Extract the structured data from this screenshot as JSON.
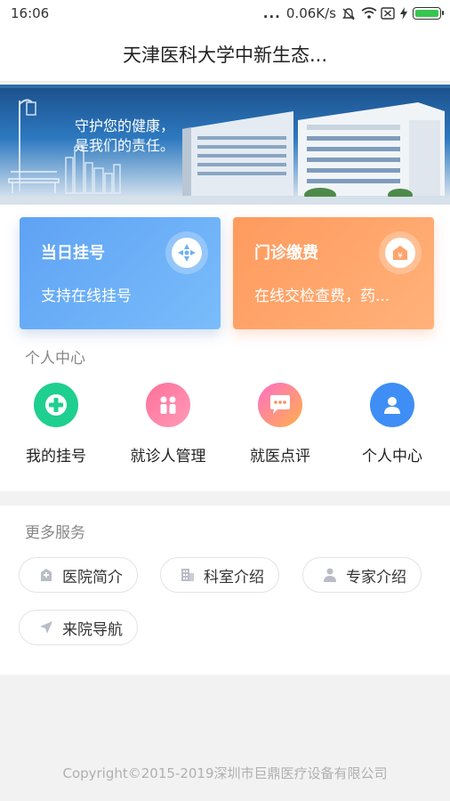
{
  "status_bar": {
    "time": "16:06",
    "dots": "...",
    "network_speed": "0.06K/s"
  },
  "header": {
    "title": "天津医科大学中新生态..."
  },
  "banner": {
    "line1": "守护您的健康，",
    "line2": "是我们的责任。"
  },
  "cards": [
    {
      "title": "当日挂号",
      "subtitle": "支持在线挂号",
      "icon": "registration-icon",
      "color": "#6aaff7"
    },
    {
      "title": "门诊缴费",
      "subtitle": "在线交检查费，药...",
      "icon": "payment-icon",
      "color": "#ffa36c"
    }
  ],
  "personal_center": {
    "label": "个人中心",
    "items": [
      {
        "label": "我的挂号",
        "icon": "plus-icon",
        "color": "#1fcf8f"
      },
      {
        "label": "就诊人管理",
        "icon": "people-icon",
        "color": "#ff6f9a"
      },
      {
        "label": "就医点评",
        "icon": "comment-icon",
        "color": "#ff8a5c"
      },
      {
        "label": "个人中心",
        "icon": "user-icon",
        "color": "#3f8ef5"
      }
    ]
  },
  "more_services": {
    "label": "更多服务",
    "items": [
      {
        "label": "医院简介",
        "icon": "hospital-icon"
      },
      {
        "label": "科室介绍",
        "icon": "building-icon"
      },
      {
        "label": "专家介绍",
        "icon": "doctor-icon"
      },
      {
        "label": "来院导航",
        "icon": "navigation-icon"
      }
    ]
  },
  "footer": {
    "copyright": "Copyright©2015-2019深圳市巨鼎医疗设备有限公司"
  }
}
